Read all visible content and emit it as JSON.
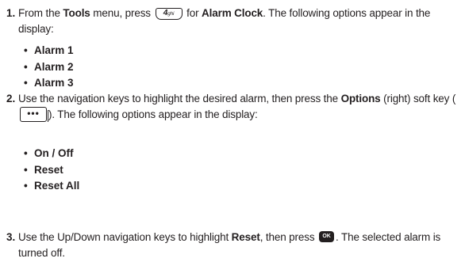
{
  "steps": [
    {
      "number": "1.",
      "t1": "From the ",
      "b1": "Tools",
      "t2": " menu, press ",
      "key": "4ghi",
      "t3": " for ",
      "b2": "Alarm Clock",
      "t4": ". The following options appear in the display:",
      "bullets": [
        "Alarm 1",
        "Alarm 2",
        "Alarm 3"
      ]
    },
    {
      "number": "2.",
      "t1": "Use the navigation keys to highlight the desired alarm, then press the ",
      "b1": "Options",
      "t2": " (right) soft key (",
      "key": "...",
      "t3": "). The following options appear in the display:",
      "bullets": [
        "On / Off",
        "Reset",
        "Reset All"
      ]
    },
    {
      "number": "3.",
      "t1": "Use the Up/Down navigation keys to highlight ",
      "b1": "Reset",
      "t2": ", then press ",
      "key": "OK",
      "t3": ". The selected alarm is turned off."
    }
  ],
  "icons": {
    "key_4": "keypad-4-icon",
    "options_key": "options-soft-key-icon",
    "ok_key": "ok-key-icon"
  }
}
